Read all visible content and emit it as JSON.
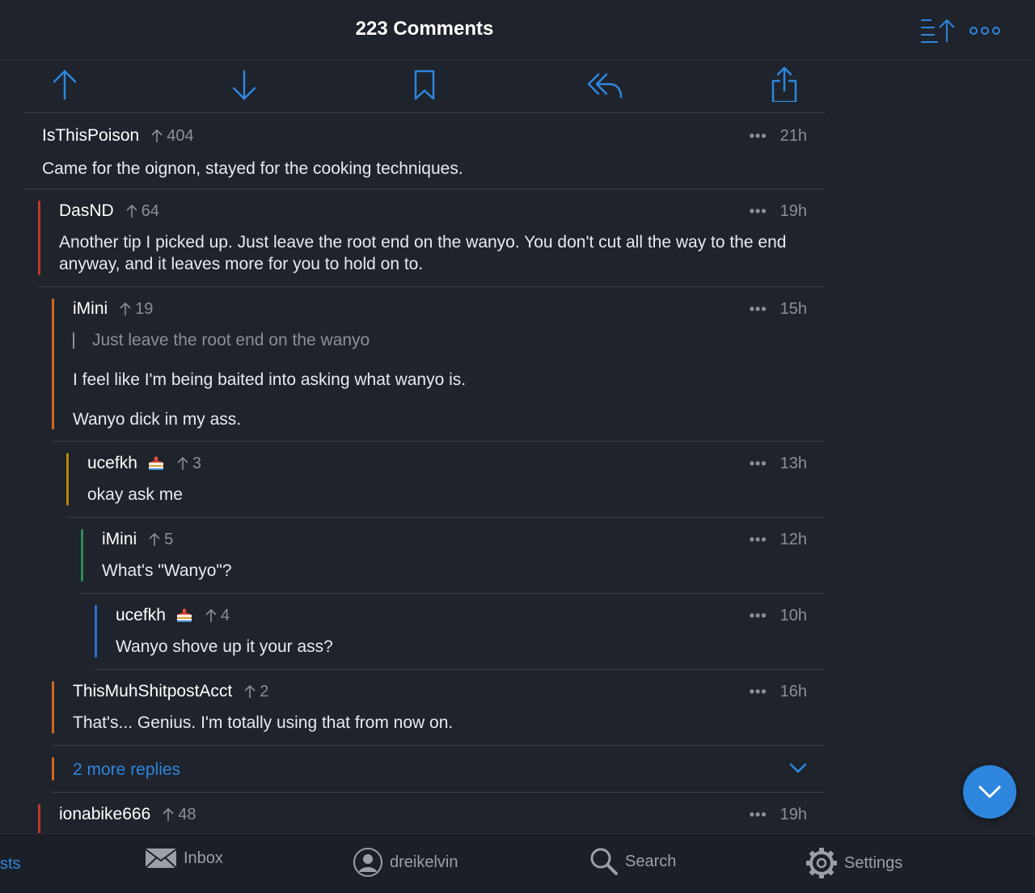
{
  "header": {
    "title": "223 Comments"
  },
  "comments": [
    {
      "author": "IsThisPoison",
      "score": "404",
      "time": "21h",
      "body": "Came for the oignon, stayed for the cooking techniques.",
      "flair": false
    },
    {
      "author": "DasND",
      "score": "64",
      "time": "19h",
      "body": "Another tip I picked up. Just leave the root end on the wanyo. You don't cut all the way to the end anyway, and it leaves more for you to hold on to.",
      "flair": false
    },
    {
      "author": "iMini",
      "score": "19",
      "time": "15h",
      "quote": "Just leave the root end on the wanyo",
      "para1": "I feel like I'm being baited into asking what wanyo is.",
      "para2": "Wanyo dick in my ass.",
      "flair": false
    },
    {
      "author": "ucefkh",
      "score": "3",
      "time": "13h",
      "body": "okay ask me",
      "flair": true
    },
    {
      "author": "iMini",
      "score": "5",
      "time": "12h",
      "body": "What's \"Wanyo\"?",
      "flair": false
    },
    {
      "author": "ucefkh",
      "score": "4",
      "time": "10h",
      "body": "Wanyo shove up it your ass?",
      "flair": true
    },
    {
      "author": "ThisMuhShitpostAcct",
      "score": "2",
      "time": "16h",
      "body": "That's... Genius. I'm totally using that from now on.",
      "flair": false
    },
    {
      "author": "ionabike666",
      "score": "48",
      "time": "19h",
      "flair": false
    }
  ],
  "more_replies": {
    "label": "2 more replies"
  },
  "tabs": [
    {
      "label": "sts",
      "icon": "posts-icon"
    },
    {
      "label": "Inbox",
      "icon": "envelope-icon"
    },
    {
      "label": "dreikelvin",
      "icon": "user-avatar-icon"
    },
    {
      "label": "Search",
      "icon": "search-icon"
    },
    {
      "label": "Settings",
      "icon": "gear-icon"
    }
  ],
  "colors": {
    "accent": "#2e86de",
    "depth1": "#c0392b",
    "depth2": "#d2691e",
    "depth3": "#b8860b",
    "depth4": "#2e8b57",
    "depth5": "#2e6fd1"
  }
}
